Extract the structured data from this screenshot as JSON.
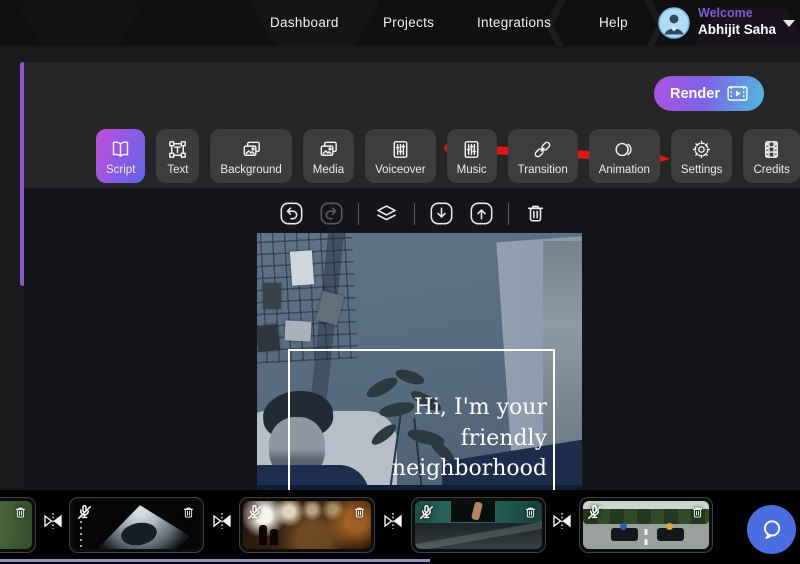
{
  "nav": {
    "items": [
      "Dashboard",
      "Projects",
      "Integrations",
      "Help"
    ],
    "welcome": "Welcome",
    "username": "Abhijit Saha"
  },
  "header": {
    "render_label": "Render"
  },
  "toolbar": {
    "items": [
      {
        "label": "Script",
        "icon": "book-icon",
        "active": true
      },
      {
        "label": "Text",
        "icon": "text-frame-icon",
        "active": false
      },
      {
        "label": "Background",
        "icon": "image-stack-icon",
        "active": false
      },
      {
        "label": "Media",
        "icon": "image-stack-icon",
        "active": false
      },
      {
        "label": "Voiceover",
        "icon": "equalizer-icon",
        "active": false
      },
      {
        "label": "Music",
        "icon": "equalizer-icon",
        "active": false
      },
      {
        "label": "Transition",
        "icon": "chain-link-icon",
        "active": false
      },
      {
        "label": "Animation",
        "icon": "overlap-circles-icon",
        "active": false
      },
      {
        "label": "Settings",
        "icon": "gear-icon",
        "active": false
      },
      {
        "label": "Credits",
        "icon": "film-strip-icon",
        "active": false
      }
    ]
  },
  "canvas_controls": {
    "items": [
      "undo",
      "redo",
      "layers",
      "download",
      "upload",
      "delete"
    ]
  },
  "preview": {
    "caption_lines": [
      "Hi, I'm your",
      "friendly",
      "neighborhood"
    ]
  },
  "timeline": {
    "clips": [
      {
        "name": "clip-forest"
      },
      {
        "name": "clip-ultrasound"
      },
      {
        "name": "clip-tunnel"
      },
      {
        "name": "clip-truck"
      },
      {
        "name": "clip-gokart"
      }
    ],
    "clip_icons": [
      "mute-icon",
      "delete-icon"
    ],
    "between_clips_icon": "transition-marker-icon"
  },
  "colors": {
    "render_gradient_start": "#ab53e0",
    "render_gradient_end": "#4fb9dd",
    "script_gradient_start": "#c24ddb",
    "script_gradient_end": "#5a68e8",
    "welcome_text": "#7a5fd0",
    "arrow_red": "#e31414",
    "scrollbar_purple": "#8a56c9",
    "chat_button_blue": "#4a6ee0",
    "progress_line": "#9d8fc4",
    "caption_text": "#ffffff"
  }
}
